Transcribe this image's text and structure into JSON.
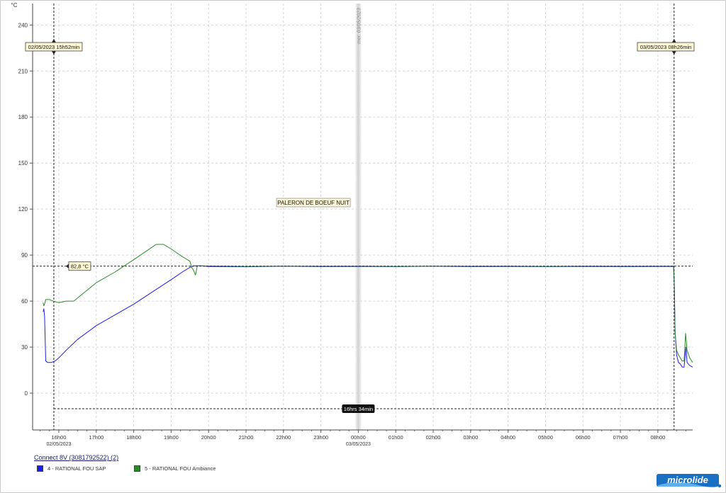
{
  "chart_data": {
    "type": "line",
    "title": "PALERON DE BOEUF NUIT",
    "ylabel": "°C",
    "ylim": [
      -24,
      254
    ],
    "yticks": [
      0,
      30,
      60,
      90,
      120,
      150,
      180,
      210,
      240
    ],
    "xlim": [
      15.3,
      32.93
    ],
    "xticks": [
      {
        "value": 16,
        "label": "16h00",
        "sublabel": "02/05/2023"
      },
      {
        "value": 17,
        "label": "17h00"
      },
      {
        "value": 18,
        "label": "18h00"
      },
      {
        "value": 19,
        "label": "19h00"
      },
      {
        "value": 20,
        "label": "20h00"
      },
      {
        "value": 21,
        "label": "21h00"
      },
      {
        "value": 22,
        "label": "22h00"
      },
      {
        "value": 23,
        "label": "23h00"
      },
      {
        "value": 24,
        "label": "00h00",
        "sublabel": "03/05/2023"
      },
      {
        "value": 25,
        "label": "01h00"
      },
      {
        "value": 26,
        "label": "02h00"
      },
      {
        "value": 27,
        "label": "03h00"
      },
      {
        "value": 28,
        "label": "04h00"
      },
      {
        "value": 29,
        "label": "05h00"
      },
      {
        "value": 30,
        "label": "06h00"
      },
      {
        "value": 31,
        "label": "07h00"
      },
      {
        "value": 32,
        "label": "08h00"
      }
    ],
    "grid": true,
    "midnight_marker": {
      "x": 24,
      "label": "mer. 03/05/2023"
    },
    "cursors": [
      {
        "x": 15.867,
        "label": "02/05/2023 15h52min"
      },
      {
        "x": 32.433,
        "label": "03/05/2023 08h26min"
      }
    ],
    "reference_line": {
      "y": 82.8,
      "label": "82,8 °C"
    },
    "duration_label": "16hrs 34min",
    "series": [
      {
        "name": "4 - RATIONAL FOU SAP",
        "color": "#1c1cf0",
        "points": [
          [
            15.58,
            53
          ],
          [
            15.6,
            55
          ],
          [
            15.62,
            50
          ],
          [
            15.65,
            21
          ],
          [
            15.7,
            20
          ],
          [
            15.8,
            20
          ],
          [
            15.9,
            21
          ],
          [
            16.0,
            23
          ],
          [
            16.2,
            28
          ],
          [
            16.5,
            35
          ],
          [
            17.0,
            44
          ],
          [
            17.5,
            51
          ],
          [
            18.0,
            58
          ],
          [
            18.5,
            66
          ],
          [
            19.0,
            74
          ],
          [
            19.3,
            79
          ],
          [
            19.5,
            82
          ],
          [
            19.6,
            83
          ],
          [
            19.8,
            83
          ],
          [
            20.0,
            82.6
          ],
          [
            21,
            82.4
          ],
          [
            22,
            82.7
          ],
          [
            23,
            82.5
          ],
          [
            24,
            82.6
          ],
          [
            25,
            82.5
          ],
          [
            26,
            82.7
          ],
          [
            27,
            82.5
          ],
          [
            28,
            82.6
          ],
          [
            29,
            82.5
          ],
          [
            30,
            82.6
          ],
          [
            31,
            82.5
          ],
          [
            32.0,
            82.6
          ],
          [
            32.42,
            82.6
          ],
          [
            32.44,
            70
          ],
          [
            32.46,
            40
          ],
          [
            32.5,
            25
          ],
          [
            32.55,
            20
          ],
          [
            32.6,
            19
          ],
          [
            32.65,
            17
          ],
          [
            32.7,
            17
          ],
          [
            32.75,
            30
          ],
          [
            32.78,
            20
          ],
          [
            32.85,
            18
          ],
          [
            32.93,
            17
          ]
        ]
      },
      {
        "name": "5 - RATIONAL FOU Ambiance",
        "color": "#2a8a2a",
        "points": [
          [
            15.58,
            59
          ],
          [
            15.6,
            57
          ],
          [
            15.62,
            58
          ],
          [
            15.65,
            61
          ],
          [
            15.75,
            61
          ],
          [
            15.85,
            60
          ],
          [
            16.0,
            59
          ],
          [
            16.2,
            60
          ],
          [
            16.4,
            60
          ],
          [
            16.6,
            64
          ],
          [
            17.0,
            72
          ],
          [
            17.5,
            79
          ],
          [
            18.0,
            87
          ],
          [
            18.3,
            92
          ],
          [
            18.6,
            97
          ],
          [
            18.8,
            97
          ],
          [
            19.0,
            94
          ],
          [
            19.3,
            89
          ],
          [
            19.5,
            86
          ],
          [
            19.55,
            82
          ],
          [
            19.6,
            80
          ],
          [
            19.65,
            77
          ],
          [
            19.7,
            83
          ],
          [
            19.75,
            83
          ],
          [
            20.0,
            82.9
          ],
          [
            21,
            82.6
          ],
          [
            22,
            82.8
          ],
          [
            23,
            82.7
          ],
          [
            24,
            82.8
          ],
          [
            25,
            82.6
          ],
          [
            26,
            82.8
          ],
          [
            27,
            82.7
          ],
          [
            28,
            82.8
          ],
          [
            29,
            82.6
          ],
          [
            30,
            82.8
          ],
          [
            31,
            82.7
          ],
          [
            32.0,
            82.8
          ],
          [
            32.42,
            82.8
          ],
          [
            32.44,
            70
          ],
          [
            32.46,
            40
          ],
          [
            32.5,
            28
          ],
          [
            32.55,
            25
          ],
          [
            32.6,
            23
          ],
          [
            32.65,
            21
          ],
          [
            32.7,
            21
          ],
          [
            32.74,
            39
          ],
          [
            32.78,
            28
          ],
          [
            32.85,
            23
          ],
          [
            32.93,
            20
          ]
        ]
      }
    ]
  },
  "legend": {
    "title": "Connect 8V  (3081792522) (2)",
    "items": [
      {
        "label": "4 - RATIONAL FOU SAP",
        "color": "#1c1cf0"
      },
      {
        "label": "5 - RATIONAL FOU Ambiance",
        "color": "#2a8a2a"
      }
    ]
  },
  "brand": {
    "name": "microlide"
  }
}
